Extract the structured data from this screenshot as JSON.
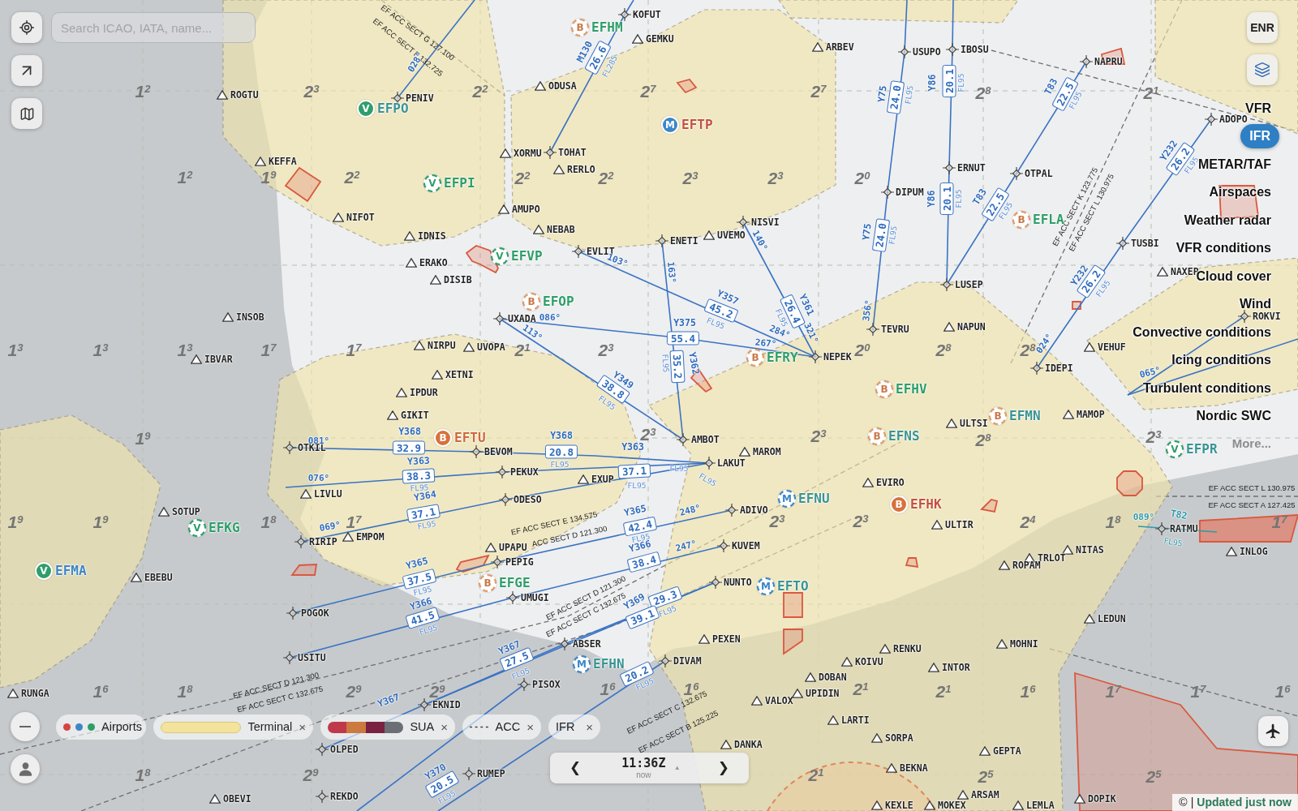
{
  "search": {
    "placeholder": "Search ICAO, IATA, name..."
  },
  "chart_type_button": {
    "label": "ENR"
  },
  "layer_menu": [
    {
      "label": "VFR",
      "selected": false
    },
    {
      "label": "IFR",
      "selected": true
    },
    {
      "label": "METAR/TAF",
      "selected": false
    },
    {
      "label": "Airspaces",
      "selected": false
    },
    {
      "label": "Weather radar",
      "selected": false
    },
    {
      "label": "VFR conditions",
      "selected": false
    },
    {
      "label": "Cloud cover",
      "selected": false
    },
    {
      "label": "Wind",
      "selected": false
    },
    {
      "label": "Convective conditions",
      "selected": false
    },
    {
      "label": "Icing conditions",
      "selected": false
    },
    {
      "label": "Turbulent conditions",
      "selected": false
    },
    {
      "label": "Nordic SWC",
      "selected": false
    }
  ],
  "more_link": "More...",
  "legend": [
    {
      "kind": "airports",
      "label": "Airports"
    },
    {
      "kind": "terminal",
      "label": "Terminal",
      "close": "×"
    },
    {
      "kind": "sua",
      "label": "SUA",
      "close": "×"
    },
    {
      "kind": "acc",
      "label": "ACC",
      "close": "×"
    },
    {
      "kind": "ifr",
      "label": "IFR",
      "close": "×"
    }
  ],
  "time_bar": {
    "prev": "❮",
    "time": "11:36Z",
    "caption": "now",
    "marker": "▴",
    "next": "❯"
  },
  "attribution": {
    "symbol": "©",
    "separator": "|",
    "status": "Updated just now"
  },
  "airports": [
    {
      "code": "EFPO",
      "letter": "V",
      "kind": "solid",
      "color": "#3a9494"
    },
    {
      "code": "EFHM",
      "letter": "B",
      "kind": "dashed",
      "color": "#2e9e6a"
    },
    {
      "code": "EFTP",
      "letter": "M",
      "kind": "solid",
      "color": "#c4513c"
    },
    {
      "code": "EFPI",
      "letter": "V",
      "kind": "dashed",
      "color": "#2e9e6a"
    },
    {
      "code": "EFVP",
      "letter": "V",
      "kind": "dashed",
      "color": "#2e9e6a"
    },
    {
      "code": "EFOP",
      "letter": "B",
      "kind": "dashed",
      "color": "#2e9e6a"
    },
    {
      "code": "EFRY",
      "letter": "B",
      "kind": "dashed",
      "color": "#2e9e6a"
    },
    {
      "code": "EFLA",
      "letter": "B",
      "kind": "dashed",
      "color": "#2e9e6a"
    },
    {
      "code": "EFHV",
      "letter": "B",
      "kind": "dashed",
      "color": "#2e9e6a"
    },
    {
      "code": "EFTU",
      "letter": "B",
      "kind": "solid",
      "color": "#cc6a3a"
    },
    {
      "code": "EFNS",
      "letter": "B",
      "kind": "dashed",
      "color": "#3a9494"
    },
    {
      "code": "EFMN",
      "letter": "B",
      "kind": "dashed",
      "color": "#3a9494"
    },
    {
      "code": "EFKG",
      "letter": "V",
      "kind": "dashed",
      "color": "#2e9e6a"
    },
    {
      "code": "EFMA",
      "letter": "V",
      "kind": "solid",
      "color": "#3d86c6"
    },
    {
      "code": "EFGE",
      "letter": "B",
      "kind": "dashed",
      "color": "#2e9e6a"
    },
    {
      "code": "EFNU",
      "letter": "M",
      "kind": "dashed",
      "color": "#3a9494"
    },
    {
      "code": "EFTO",
      "letter": "M",
      "kind": "dashed",
      "color": "#3a9494"
    },
    {
      "code": "EFHN",
      "letter": "M",
      "kind": "dashed",
      "color": "#3a9494"
    },
    {
      "code": "EFHK",
      "letter": "B",
      "kind": "solid",
      "color": "#c4513c"
    },
    {
      "code": "EFPR",
      "letter": "V",
      "kind": "dashed",
      "color": "#3a9494"
    }
  ],
  "waypoints": [
    {
      "name": "ROGTU",
      "kind": "triangle"
    },
    {
      "name": "KEFFA",
      "kind": "triangle"
    },
    {
      "name": "NIFOT",
      "kind": "triangle"
    },
    {
      "name": "IDNIS",
      "kind": "triangle"
    },
    {
      "name": "ERAKO",
      "kind": "triangle"
    },
    {
      "name": "DISIB",
      "kind": "triangle"
    },
    {
      "name": "INSOB",
      "kind": "triangle"
    },
    {
      "name": "IBVAR",
      "kind": "triangle"
    },
    {
      "name": "NIRPU",
      "kind": "triangle"
    },
    {
      "name": "XETNI",
      "kind": "triangle"
    },
    {
      "name": "UVOPA",
      "kind": "triangle"
    },
    {
      "name": "IPDUR",
      "kind": "triangle"
    },
    {
      "name": "GIKIT",
      "kind": "triangle"
    },
    {
      "name": "PENIV",
      "kind": "cross"
    },
    {
      "name": "KOFUT",
      "kind": "cross"
    },
    {
      "name": "GEMKU",
      "kind": "triangle"
    },
    {
      "name": "ARBEV",
      "kind": "triangle"
    },
    {
      "name": "ODUSA",
      "kind": "triangle"
    },
    {
      "name": "XORMU",
      "kind": "triangle"
    },
    {
      "name": "TOHAT",
      "kind": "cross"
    },
    {
      "name": "RERLO",
      "kind": "triangle"
    },
    {
      "name": "AMUPO",
      "kind": "triangle"
    },
    {
      "name": "NEBAB",
      "kind": "triangle"
    },
    {
      "name": "EVLIT",
      "kind": "cross"
    },
    {
      "name": "ENETI",
      "kind": "cross"
    },
    {
      "name": "UVEMO",
      "kind": "triangle"
    },
    {
      "name": "NISVI",
      "kind": "cross"
    },
    {
      "name": "UXADA",
      "kind": "cross"
    },
    {
      "name": "NEPEK",
      "kind": "cross"
    },
    {
      "name": "USUPO",
      "kind": "cross"
    },
    {
      "name": "IBOSU",
      "kind": "cross"
    },
    {
      "name": "NAPRU",
      "kind": "cross"
    },
    {
      "name": "ERNUT",
      "kind": "cross"
    },
    {
      "name": "OTPAL",
      "kind": "cross"
    },
    {
      "name": "DIPUM",
      "kind": "cross"
    },
    {
      "name": "LUSEP",
      "kind": "cross"
    },
    {
      "name": "TEVRU",
      "kind": "cross"
    },
    {
      "name": "NAPUN",
      "kind": "triangle"
    },
    {
      "name": "IDEPI",
      "kind": "cross"
    },
    {
      "name": "VEHUF",
      "kind": "triangle"
    },
    {
      "name": "TUSBI",
      "kind": "cross"
    },
    {
      "name": "NAXEP",
      "kind": "triangle"
    },
    {
      "name": "ADOPO",
      "kind": "cross"
    },
    {
      "name": "ROKVI",
      "kind": "cross"
    },
    {
      "name": "OTKIL",
      "kind": "cross"
    },
    {
      "name": "LIVLU",
      "kind": "triangle"
    },
    {
      "name": "SOTUP",
      "kind": "triangle"
    },
    {
      "name": "RIRIP",
      "kind": "cross"
    },
    {
      "name": "EMPOM",
      "kind": "triangle"
    },
    {
      "name": "EBEBU",
      "kind": "triangle"
    },
    {
      "name": "POGOK",
      "kind": "cross"
    },
    {
      "name": "USITU",
      "kind": "cross"
    },
    {
      "name": "RUNGA",
      "kind": "triangle"
    },
    {
      "name": "OLPED",
      "kind": "cross"
    },
    {
      "name": "OBEVI",
      "kind": "triangle"
    },
    {
      "name": "REKDO",
      "kind": "cross"
    },
    {
      "name": "EKNID",
      "kind": "cross"
    },
    {
      "name": "BEVOM",
      "kind": "cross"
    },
    {
      "name": "PEKUX",
      "kind": "cross"
    },
    {
      "name": "EXUP",
      "kind": "triangle"
    },
    {
      "name": "ODESO",
      "kind": "cross"
    },
    {
      "name": "AMBOT",
      "kind": "cross"
    },
    {
      "name": "LAKUT",
      "kind": "cross"
    },
    {
      "name": "MAROM",
      "kind": "triangle"
    },
    {
      "name": "ADIVO",
      "kind": "cross"
    },
    {
      "name": "KUVEM",
      "kind": "cross"
    },
    {
      "name": "NUNTO",
      "kind": "cross"
    },
    {
      "name": "UPAPU",
      "kind": "triangle"
    },
    {
      "name": "PEPIG",
      "kind": "cross"
    },
    {
      "name": "UMUGI",
      "kind": "cross"
    },
    {
      "name": "ABSER",
      "kind": "cross"
    },
    {
      "name": "PISOX",
      "kind": "cross"
    },
    {
      "name": "DIVAM",
      "kind": "cross"
    },
    {
      "name": "PEXEN",
      "kind": "triangle"
    },
    {
      "name": "VALOX",
      "kind": "triangle"
    },
    {
      "name": "DOBAN",
      "kind": "triangle"
    },
    {
      "name": "UPIDIN",
      "kind": "triangle"
    },
    {
      "name": "KOIVU",
      "kind": "triangle"
    },
    {
      "name": "LARTI",
      "kind": "triangle"
    },
    {
      "name": "DANKA",
      "kind": "triangle"
    },
    {
      "name": "RUMEP",
      "kind": "cross"
    },
    {
      "name": "ULTSI",
      "kind": "triangle"
    },
    {
      "name": "MAMOP",
      "kind": "triangle"
    },
    {
      "name": "EVIRO",
      "kind": "triangle"
    },
    {
      "name": "ULTIR",
      "kind": "triangle"
    },
    {
      "name": "NITAS",
      "kind": "triangle"
    },
    {
      "name": "TRLOT",
      "kind": "triangle"
    },
    {
      "name": "ROPAM",
      "kind": "triangle"
    },
    {
      "name": "INLOG",
      "kind": "triangle"
    },
    {
      "name": "LEDUN",
      "kind": "triangle"
    },
    {
      "name": "RENKU",
      "kind": "triangle"
    },
    {
      "name": "MOHNI",
      "kind": "triangle"
    },
    {
      "name": "INTOR",
      "kind": "triangle"
    },
    {
      "name": "SORPA",
      "kind": "triangle"
    },
    {
      "name": "GEPTA",
      "kind": "triangle"
    },
    {
      "name": "BEKNA",
      "kind": "triangle"
    },
    {
      "name": "ARSAM",
      "kind": "triangle"
    },
    {
      "name": "KEXLE",
      "kind": "triangle"
    },
    {
      "name": "MOKEX",
      "kind": "triangle"
    },
    {
      "name": "LEMLA",
      "kind": "triangle"
    },
    {
      "name": "DOPIK",
      "kind": "triangle"
    },
    {
      "name": "RATMU",
      "kind": "cross"
    }
  ],
  "airway_labels": [
    {
      "kind": "name",
      "text": "M130"
    },
    {
      "kind": "distance",
      "text": "26.6"
    },
    {
      "kind": "level",
      "text": "FL285"
    },
    {
      "kind": "bearing",
      "text": "028°"
    },
    {
      "kind": "bearing",
      "text": "103°"
    },
    {
      "kind": "bearing",
      "text": "163°"
    },
    {
      "kind": "bearing",
      "text": "140°"
    },
    {
      "kind": "name",
      "text": "Y357"
    },
    {
      "kind": "distance",
      "text": "45.2"
    },
    {
      "kind": "level",
      "text": "FL95"
    },
    {
      "kind": "name",
      "text": "Y361"
    },
    {
      "kind": "distance",
      "text": "26.4"
    },
    {
      "kind": "level",
      "text": "FL95"
    },
    {
      "kind": "bearing",
      "text": "321°"
    },
    {
      "kind": "bearing",
      "text": "284°"
    },
    {
      "kind": "bearing",
      "text": "267°"
    },
    {
      "kind": "bearing",
      "text": "086°"
    },
    {
      "kind": "bearing",
      "text": "113°"
    },
    {
      "kind": "name",
      "text": "Y375"
    },
    {
      "kind": "distance",
      "text": "55.4"
    },
    {
      "kind": "name",
      "text": "Y362"
    },
    {
      "kind": "distance",
      "text": "35.2"
    },
    {
      "kind": "level",
      "text": "FL95"
    },
    {
      "kind": "name",
      "text": "Y349"
    },
    {
      "kind": "distance",
      "text": "38.8"
    },
    {
      "kind": "level",
      "text": "FL95"
    },
    {
      "kind": "name",
      "text": "Y75"
    },
    {
      "kind": "distance",
      "text": "24.0"
    },
    {
      "kind": "level",
      "text": "FL95"
    },
    {
      "kind": "name",
      "text": "Y86"
    },
    {
      "kind": "distance",
      "text": "20.1"
    },
    {
      "kind": "level",
      "text": "FL95"
    },
    {
      "kind": "name",
      "text": "T83"
    },
    {
      "kind": "distance",
      "text": "22.5"
    },
    {
      "kind": "level",
      "text": "FL95"
    },
    {
      "kind": "name",
      "text": "Y75"
    },
    {
      "kind": "distance",
      "text": "24.0"
    },
    {
      "kind": "level",
      "text": "FL95"
    },
    {
      "kind": "name",
      "text": "Y86"
    },
    {
      "kind": "distance",
      "text": "20.1"
    },
    {
      "kind": "level",
      "text": "FL95"
    },
    {
      "kind": "name",
      "text": "T83"
    },
    {
      "kind": "distance",
      "text": "22.5"
    },
    {
      "kind": "level",
      "text": "FL95"
    },
    {
      "kind": "bearing",
      "text": "356°"
    },
    {
      "kind": "name",
      "text": "Y232"
    },
    {
      "kind": "distance",
      "text": "26.2"
    },
    {
      "kind": "level",
      "text": "FL95"
    },
    {
      "kind": "name",
      "text": "Y232"
    },
    {
      "kind": "distance",
      "text": "26.2"
    },
    {
      "kind": "level",
      "text": "FL95"
    },
    {
      "kind": "bearing",
      "text": "024°"
    },
    {
      "kind": "bearing",
      "text": "065°"
    },
    {
      "kind": "name",
      "text": "Y368"
    },
    {
      "kind": "distance",
      "text": "32.9"
    },
    {
      "kind": "bearing",
      "text": "081°"
    },
    {
      "kind": "name",
      "text": "Y363"
    },
    {
      "kind": "distance",
      "text": "38.3"
    },
    {
      "kind": "level",
      "text": "FL95"
    },
    {
      "kind": "bearing",
      "text": "076°"
    },
    {
      "kind": "name",
      "text": "Y364"
    },
    {
      "kind": "distance",
      "text": "37.1"
    },
    {
      "kind": "level",
      "text": "FL95"
    },
    {
      "kind": "bearing",
      "text": "069°"
    },
    {
      "kind": "name",
      "text": "Y365"
    },
    {
      "kind": "distance",
      "text": "37.5"
    },
    {
      "kind": "level",
      "text": "FL95"
    },
    {
      "kind": "name",
      "text": "Y366"
    },
    {
      "kind": "distance",
      "text": "41.5"
    },
    {
      "kind": "level",
      "text": "FL95"
    },
    {
      "kind": "name",
      "text": "Y367"
    },
    {
      "kind": "name",
      "text": "Y368"
    },
    {
      "kind": "distance",
      "text": "20.8"
    },
    {
      "kind": "level",
      "text": "FL95"
    },
    {
      "kind": "name",
      "text": "Y363"
    },
    {
      "kind": "distance",
      "text": "37.1"
    },
    {
      "kind": "level",
      "text": "FL95"
    },
    {
      "kind": "level",
      "text": "FL95"
    },
    {
      "kind": "level",
      "text": "FL95"
    },
    {
      "kind": "name",
      "text": "Y365"
    },
    {
      "kind": "distance",
      "text": "42.4"
    },
    {
      "kind": "level",
      "text": "FL95"
    },
    {
      "kind": "bearing",
      "text": "248°"
    },
    {
      "kind": "name",
      "text": "Y366"
    },
    {
      "kind": "distance",
      "text": "38.4"
    },
    {
      "kind": "bearing",
      "text": "247°"
    },
    {
      "kind": "distance",
      "text": "29.3"
    },
    {
      "kind": "name",
      "text": "Y369"
    },
    {
      "kind": "distance",
      "text": "39.1"
    },
    {
      "kind": "level",
      "text": "FL95"
    },
    {
      "kind": "name",
      "text": "Y367"
    },
    {
      "kind": "distance",
      "text": "27.5"
    },
    {
      "kind": "level",
      "text": "FL95"
    },
    {
      "kind": "distance",
      "text": "20.2"
    },
    {
      "kind": "level",
      "text": "FL95"
    },
    {
      "kind": "name",
      "text": "Y370"
    },
    {
      "kind": "distance",
      "text": "20.5"
    },
    {
      "kind": "level",
      "text": "FL95"
    },
    {
      "kind": "bearing",
      "text": "089°",
      "color": "#2f9aa8"
    },
    {
      "kind": "name",
      "text": "T82",
      "color": "#2f9aa8"
    },
    {
      "kind": "level",
      "text": "FL95",
      "color": "#2f9aa8"
    }
  ],
  "sector_labels": [
    "EF ACC SECT G 127.100",
    "EF ACC SECT F 132.725",
    "EF ACC SECT E 134.575",
    "ACC SECT D 121.300",
    "EF ACC SECT D 121.300",
    "EF ACC SECT C 132.675",
    "EF ACC SECT C 132.675",
    "EF ACC SECT B 125.225",
    "EF ACC SECT D 121.300",
    "EF ACC SECT C 132.675",
    "EF ACC SECT K 123.775",
    "EF ACC SECT L 130.975",
    "EF ACC SECT L 130.975",
    "EF ACC SECT A 127.425"
  ],
  "grid_labels": [
    "1$^{2}$",
    "2$^{3}$",
    "2$^{2}$",
    "2$^{7}$",
    "2$^{7}$",
    "2$^{8}$",
    "2$^{1}$",
    "1$^{2}$",
    "1$^{9}$",
    "2$^{2}$",
    "2$^{2}$",
    "2$^{2}$",
    "2$^{3}$",
    "2$^{3}$",
    "2$^{0}$",
    "1$^{3}$",
    "1$^{3}$",
    "1$^{3}$",
    "1$^{7}$",
    "1$^{7}$",
    "2$^{1}$",
    "2$^{3}$",
    "2$^{0}$",
    "2$^{8}$",
    "2$^{8}$",
    "1$^{9}$",
    "2$^{3}$",
    "2$^{3}$",
    "2$^{8}$",
    "2$^{3}$",
    "1$^{9}$",
    "1$^{9}$",
    "1$^{8}$",
    "1$^{7}$",
    "2$^{3}$",
    "2$^{3}$",
    "2$^{4}$",
    "1$^{8}$",
    "1$^{7}$",
    "1$^{6}$",
    "1$^{8}$",
    "2$^{9}$",
    "2$^{9}$",
    "1$^{6}$",
    "1$^{6}$",
    "2$^{1}$",
    "2$^{1}$",
    "1$^{6}$",
    "1$^{7}$",
    "1$^{7}$",
    "1$^{6}$",
    "1$^{8}$",
    "2$^{9}$",
    "2$^{1}$",
    "2$^{5}$",
    "2$^{5}$"
  ]
}
